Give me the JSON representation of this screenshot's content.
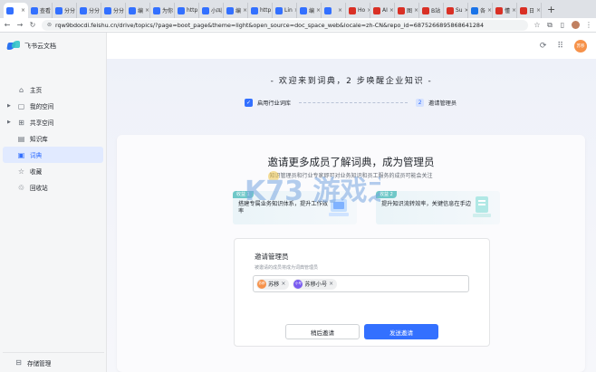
{
  "browser": {
    "tabs": [
      {
        "label": "",
        "color": "#3370ff",
        "active": true
      },
      {
        "label": "查看",
        "color": "#3370ff"
      },
      {
        "label": "分分",
        "color": "#3370ff"
      },
      {
        "label": "分分",
        "color": "#3370ff"
      },
      {
        "label": "分分",
        "color": "#3370ff"
      },
      {
        "label": "编",
        "color": "#3370ff"
      },
      {
        "label": "为你",
        "color": "#3370ff"
      },
      {
        "label": "http",
        "color": "#3370ff"
      },
      {
        "label": "小叫",
        "color": "#3370ff"
      },
      {
        "label": "编",
        "color": "#3370ff"
      },
      {
        "label": "http",
        "color": "#3370ff"
      },
      {
        "label": "Lin",
        "color": "#3370ff"
      },
      {
        "label": "编",
        "color": "#3370ff"
      },
      {
        "label": "",
        "color": "#3370ff"
      },
      {
        "label": "Ho",
        "color": "#d93025"
      },
      {
        "label": "AI",
        "color": "#d93025"
      },
      {
        "label": "图",
        "color": "#d93025"
      },
      {
        "label": "B站",
        "color": "#d93025"
      },
      {
        "label": "Su",
        "color": "#d93025"
      },
      {
        "label": "各",
        "color": "#1a73e8"
      },
      {
        "label": "懂",
        "color": "#d93025"
      },
      {
        "label": "日",
        "color": "#d93025"
      }
    ],
    "new_tab": "+",
    "url": "rqw9bdocdi.feishu.cn/drive/topics/?page=boot_page&theme=light&open_source=doc_space_web&locale=zh-CN&repo_id=6875266895868641284"
  },
  "sidebar": {
    "brand": "飞书云文档",
    "items": [
      {
        "label": "主页",
        "icon": "home-icon",
        "glyph": "⌂",
        "caret": false,
        "active": false
      },
      {
        "label": "我的空间",
        "icon": "folder-icon",
        "glyph": "▢",
        "caret": true,
        "active": false
      },
      {
        "label": "共享空间",
        "icon": "share-icon",
        "glyph": "⊞",
        "caret": true,
        "active": false
      },
      {
        "label": "知识库",
        "icon": "book-icon",
        "glyph": "▤",
        "caret": false,
        "active": false
      },
      {
        "label": "词典",
        "icon": "dictionary-icon",
        "glyph": "▣",
        "caret": false,
        "active": true
      },
      {
        "label": "收藏",
        "icon": "star-icon",
        "glyph": "☆",
        "caret": false,
        "active": false
      },
      {
        "label": "回收站",
        "icon": "trash-icon",
        "glyph": "♲",
        "caret": false,
        "active": false
      }
    ],
    "storage": "存储管理"
  },
  "topbar": {
    "avatar": "苏移"
  },
  "main": {
    "welcome": "- 欢迎来到词典，2 步唤醒企业知识 -",
    "steps": [
      {
        "badge": "✓",
        "label": "启用行业词库"
      },
      {
        "badge": "2",
        "label": "邀请管理员"
      }
    ],
    "card": {
      "title": "邀请更多成员了解词典，成为管理员",
      "subtitle": "知识管理员和行业专家即可对业务知识和员工服务的成员可能会关注",
      "benefits": [
        {
          "tag": "收益 1",
          "text": "搭建专属业务知识体系，提升工作效率"
        },
        {
          "tag": "收益 2",
          "text": "提升知识流转效率，关键信息在手边"
        }
      ],
      "invite": {
        "title": "邀请管理员",
        "hint": "被邀请的成员将成为词典管理员",
        "members": [
          {
            "name": "苏移",
            "avatar_text": "苏移",
            "color": "#f6924a"
          },
          {
            "name": "苏移小号",
            "avatar_text": "小号",
            "color": "#7a5cf0"
          }
        ],
        "later_label": "稍后邀请",
        "send_label": "发送邀请"
      }
    }
  },
  "watermark": "K73 游戏之家 .com"
}
